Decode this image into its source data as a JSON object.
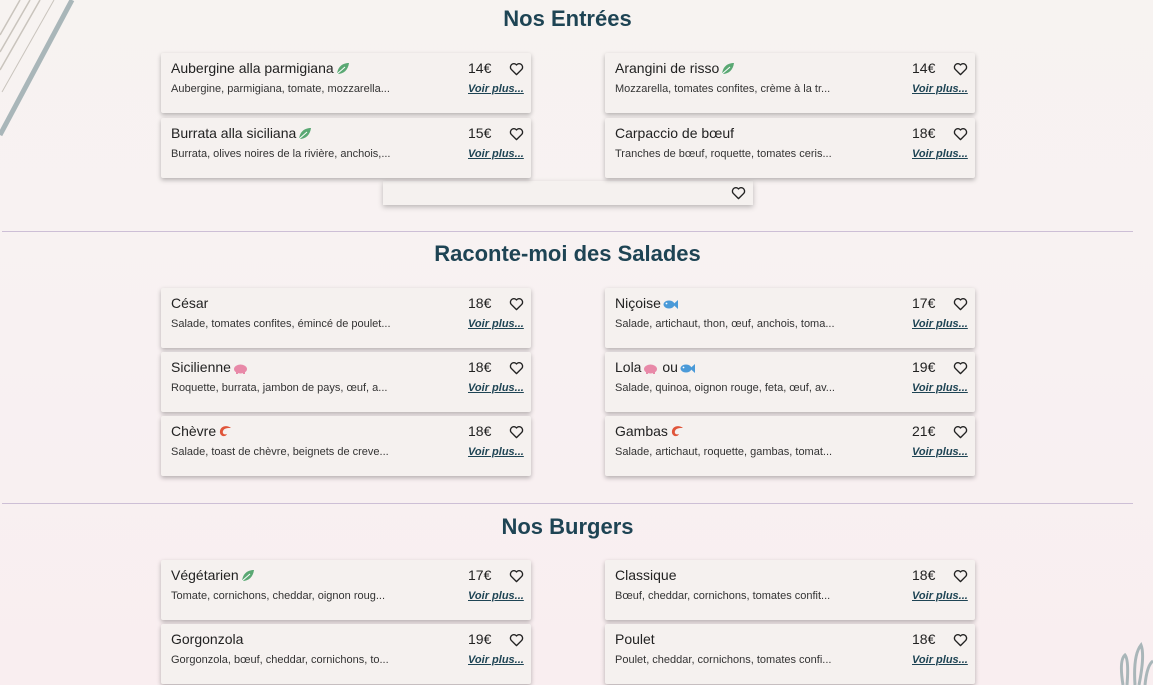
{
  "sections": [
    {
      "title": "Nos Entrées",
      "items": [
        {
          "name": "Aubergine alla parmigiana",
          "price": "14€",
          "desc": "Aubergine, parmigiana, tomate, mozzarella...",
          "tags": [
            "leaf-icon"
          ]
        },
        {
          "name": "Arangini de risso",
          "price": "14€",
          "desc": "Mozzarella, tomates confites, crème à la tr...",
          "tags": [
            "leaf-icon"
          ]
        },
        {
          "name": "Burrata alla siciliana",
          "price": "15€",
          "desc": "Burrata, olives noires de la rivière, anchois,...",
          "tags": [
            "leaf-icon"
          ]
        },
        {
          "name": "Carpaccio de bœuf",
          "price": "18€",
          "desc": "Tranches de bœuf, roquette, tomates ceris...",
          "tags": []
        }
      ]
    },
    {
      "title": "Raconte-moi des Salades",
      "items": [
        {
          "name": "César",
          "price": "18€",
          "desc": "Salade, tomates confites, émincé de poulet...",
          "tags": []
        },
        {
          "name": "Niçoise",
          "price": "17€",
          "desc": "Salade, artichaut, thon, œuf, anchois, toma...",
          "tags": [
            "fish-icon"
          ]
        },
        {
          "name": "Sicilienne",
          "price": "18€",
          "desc": "Roquette, burrata, jambon de pays, œuf, a...",
          "tags": [
            "pig-icon"
          ]
        },
        {
          "name": "Lola",
          "name_mid": "ou",
          "price": "19€",
          "desc": "Salade, quinoa, oignon rouge, feta, œuf, av...",
          "tags": [
            "pig-icon",
            "fish-icon"
          ]
        },
        {
          "name": "Chèvre",
          "price": "18€",
          "desc": "Salade, toast de chèvre, beignets de creve...",
          "tags": [
            "shrimp-icon"
          ]
        },
        {
          "name": "Gambas",
          "price": "21€",
          "desc": "Salade, artichaut, roquette, gambas, tomat...",
          "tags": [
            "shrimp-icon"
          ]
        }
      ]
    },
    {
      "title": "Nos Burgers",
      "items": [
        {
          "name": "Végétarien",
          "price": "17€",
          "desc": "Tomate, cornichons, cheddar, oignon roug...",
          "tags": [
            "leaf-icon"
          ]
        },
        {
          "name": "Classique",
          "price": "18€",
          "desc": "Bœuf, cheddar, cornichons, tomates confit...",
          "tags": []
        },
        {
          "name": "Gorgonzola",
          "price": "19€",
          "desc": "Gorgonzola, bœuf, cheddar, cornichons, to...",
          "tags": []
        },
        {
          "name": "Poulet",
          "price": "18€",
          "desc": "Poulet, cheddar, cornichons, tomates confi...",
          "tags": []
        }
      ]
    }
  ],
  "voir_plus_label": "Voir plus...",
  "colors": {
    "title": "#1e4454",
    "leaf": "#5aa873",
    "fish": "#4a9ad8",
    "pig": "#e889a8",
    "shrimp": "#e0553a"
  }
}
